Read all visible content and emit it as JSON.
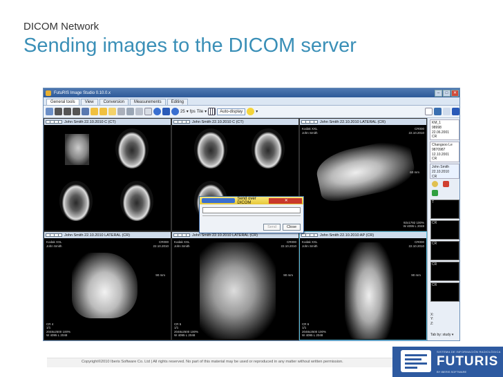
{
  "slide": {
    "subtitle": "DICOM Network",
    "title": "Sending images to the DICOM server"
  },
  "app": {
    "window_title": "FutuRIS Image Studio 0.10.0.x",
    "tabs": [
      {
        "label": "General tools",
        "active": true
      },
      {
        "label": "View",
        "active": false
      },
      {
        "label": "Conversion",
        "active": false
      },
      {
        "label": "Measurements",
        "active": false
      },
      {
        "label": "Editing",
        "active": false
      }
    ],
    "toolbar": {
      "fps_value": "25",
      "fps_label": "fps",
      "tile_label": "Tile",
      "auto_display_label": "Auto-display"
    },
    "panes": [
      {
        "header": "John Smith  22.10.2010  C  (CT)"
      },
      {
        "header": "John Smith  22.10.2010  C  (CT)"
      },
      {
        "header": "John Smith  22.10.2010  LATERAL (CR)"
      },
      {
        "header": "John Smith  22.10.2010  LATERAL (CR)"
      },
      {
        "header": "John Smith  22.10.2010  LATERAL (CR)"
      },
      {
        "header": "John Smith  22.10.2010  AP (CR)"
      }
    ],
    "overlays": {
      "kodak_name": "Kodak XXL",
      "patient_name": "John Smith",
      "cr_code": "CR000",
      "date": "22.10.2010",
      "ruler": "90 mm",
      "ruler_hand": "60 mm",
      "cr4": "CR 4",
      "cr5": "CR 5",
      "cr6": "CR 6",
      "frame": "1/1",
      "size": "2048x2500 100%",
      "wl": "W 4095 L 2048",
      "size_hand": "92x1792 100%",
      "wl_hand": "W 4095 L 2048"
    },
    "dialog": {
      "title": "Send over DICOM",
      "send_label": "Send",
      "close_label": "Close"
    },
    "sidebar": {
      "patients": [
        {
          "name": "KM_1",
          "id": "98998",
          "date": "22.06.2001",
          "modality": "CR"
        },
        {
          "name": "Changsoo Le",
          "id": "9870987",
          "date": "12.10.2001",
          "modality": "CR"
        },
        {
          "name": "John Smith",
          "id": "",
          "date": "22.10.2010",
          "modality": "CR"
        }
      ],
      "thumbs": [
        "T",
        "CR",
        "1",
        "CR",
        "CR",
        "1",
        "CR"
      ],
      "coords": {
        "x": "X:",
        "y": "Y:",
        "z": "Z:"
      },
      "tab_by_label": "Tab by:",
      "tab_by_value": "study"
    }
  },
  "footer": {
    "copyright": "Copyright©2010 Iberis Software Co. Ltd | All rights reserved. No part of this material may be used or reproduced in any matter without written permission.",
    "logo_text": "FUTURIS",
    "logo_small": "SISTEMA DE INFORMACIÓN RADIOLÓGICA",
    "logo_sub": "BY IBERIS SOFTWARE"
  }
}
